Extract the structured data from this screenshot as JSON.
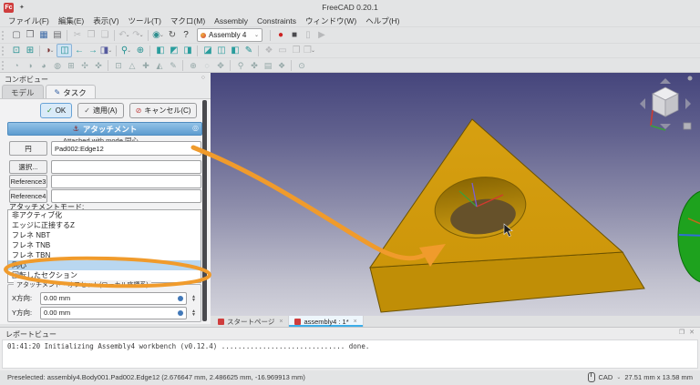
{
  "window": {
    "title": "FreeCAD 0.20.1",
    "logo_text": "Fc"
  },
  "menubar": {
    "items": [
      {
        "name": "menu-file",
        "label": "ファイル(F)"
      },
      {
        "name": "menu-edit",
        "label": "編集(E)"
      },
      {
        "name": "menu-view",
        "label": "表示(V)"
      },
      {
        "name": "menu-tools",
        "label": "ツール(T)"
      },
      {
        "name": "menu-macro",
        "label": "マクロ(M)"
      },
      {
        "name": "menu-assembly",
        "label": "Assembly"
      },
      {
        "name": "menu-constraints",
        "label": "Constraints"
      },
      {
        "name": "menu-windows",
        "label": "ウィンドウ(W)"
      },
      {
        "name": "menu-help",
        "label": "ヘルプ(H)"
      }
    ]
  },
  "workbench_selector": {
    "value": "Assembly 4",
    "dd_icon": "⌄"
  },
  "toolbars": {
    "file": [
      {
        "name": "new-file-icon",
        "glyph": "▢",
        "color": "#6b6b6f"
      },
      {
        "name": "open-file-icon",
        "glyph": "❒",
        "color": "#6b6b6f"
      },
      {
        "name": "save-icon",
        "glyph": "▦",
        "color": "#3f6ca8"
      },
      {
        "name": "print-icon",
        "glyph": "▤",
        "color": "#6b6b6f"
      },
      {
        "name": "separator",
        "cls": "sep",
        "interactable": false
      },
      {
        "name": "cut-icon",
        "glyph": "✂",
        "cls": "disabled"
      },
      {
        "name": "copy-icon",
        "glyph": "❐",
        "cls": "disabled"
      },
      {
        "name": "paste-icon",
        "glyph": "❏",
        "cls": "disabled"
      },
      {
        "name": "separator",
        "cls": "sep",
        "interactable": false
      },
      {
        "name": "undo-icon",
        "glyph": "↶",
        "dd": "⌄",
        "cls": "disabled"
      },
      {
        "name": "redo-icon",
        "glyph": "↷",
        "dd": "⌄",
        "cls": "disabled"
      },
      {
        "name": "separator",
        "cls": "sep",
        "interactable": false
      },
      {
        "name": "workbench-shield-icon",
        "glyph": "◉",
        "dd": "⌄",
        "color": "#2e8f8f"
      },
      {
        "name": "refresh-icon",
        "glyph": "↻",
        "color": "#555"
      },
      {
        "name": "whats-this-icon",
        "glyph": "?",
        "color": "#333"
      }
    ],
    "macro": [
      {
        "name": "separator",
        "cls": "sep",
        "interactable": false
      },
      {
        "name": "macro-record-icon",
        "glyph": "●",
        "color": "#cc2222"
      },
      {
        "name": "macro-stop-icon",
        "glyph": "■",
        "color": "#4a4a4e"
      },
      {
        "name": "macro-step-icon",
        "glyph": "▯",
        "cls": "disabled"
      },
      {
        "name": "macro-play-icon",
        "glyph": "▶",
        "cls": "disabled"
      }
    ],
    "view": [
      {
        "name": "fit-all-icon",
        "glyph": "⊡",
        "color": "#1f8f8f"
      },
      {
        "name": "fit-selection-icon",
        "glyph": "⊞",
        "color": "#1f8f8f"
      },
      {
        "name": "separator",
        "cls": "sep",
        "interactable": false
      },
      {
        "name": "draw-style-icon",
        "glyph": "◑",
        "dd": "⌄",
        "color": "#7a3030"
      },
      {
        "name": "isometric-view-icon",
        "glyph": "◫",
        "color": "#1f8f8f",
        "cls": "active"
      },
      {
        "name": "view-back-icon",
        "glyph": "←",
        "color": "#2a9d9d"
      },
      {
        "name": "view-forward-icon",
        "glyph": "→",
        "color": "#2a9d9d"
      },
      {
        "name": "std-views-icon",
        "glyph": "◨",
        "dd": "⌄",
        "color": "#555a9e"
      },
      {
        "name": "separator",
        "cls": "sep",
        "interactable": false
      },
      {
        "name": "zoom-icon",
        "glyph": "⚲",
        "dd": "⌄",
        "color": "#1f8f8f"
      },
      {
        "name": "axonometric-icon",
        "glyph": "⊕",
        "color": "#1f8f8f"
      },
      {
        "name": "separator",
        "cls": "sep",
        "interactable": false
      },
      {
        "name": "view-front-icon",
        "glyph": "◧",
        "color": "#2a9d9d"
      },
      {
        "name": "view-top-icon",
        "glyph": "◩",
        "color": "#2a9d9d"
      },
      {
        "name": "view-right-icon",
        "glyph": "◨",
        "color": "#2a9d9d"
      },
      {
        "name": "separator",
        "cls": "sep",
        "interactable": false
      },
      {
        "name": "view-rear-icon",
        "glyph": "◪",
        "color": "#2a9d9d"
      },
      {
        "name": "view-bottom-icon",
        "glyph": "◫",
        "color": "#2a9d9d"
      },
      {
        "name": "view-left-icon",
        "glyph": "◧",
        "color": "#2a9d9d"
      },
      {
        "name": "measure-icon",
        "glyph": "✎",
        "color": "#1f8f8f"
      },
      {
        "name": "separator",
        "cls": "sep",
        "interactable": false
      },
      {
        "name": "sync-view-icon",
        "glyph": "❖",
        "cls": "disabled"
      },
      {
        "name": "box-select-icon",
        "glyph": "▭",
        "cls": "disabled"
      },
      {
        "name": "clip-plane-icon",
        "glyph": "❐",
        "cls": "disabled"
      },
      {
        "name": "persp-ortho-icon",
        "glyph": "❒",
        "dd": "⌄",
        "cls": "disabled"
      }
    ],
    "asm4": [
      {
        "name": "asm4-tool-icon-1",
        "glyph": "◔",
        "cls": "pale"
      },
      {
        "name": "asm4-tool-icon-2",
        "glyph": "◑",
        "cls": "pale"
      },
      {
        "name": "asm4-tool-icon-3",
        "glyph": "◕",
        "cls": "pale"
      },
      {
        "name": "asm4-tool-icon-4",
        "glyph": "◍",
        "cls": "pale"
      },
      {
        "name": "asm4-tool-icon-5",
        "glyph": "⊞",
        "cls": "pale"
      },
      {
        "name": "asm4-tool-icon-6",
        "glyph": "✣",
        "cls": "pale"
      },
      {
        "name": "asm4-tool-icon-7",
        "glyph": "✜",
        "cls": "pale"
      },
      {
        "name": "separator",
        "cls": "sep",
        "interactable": false
      },
      {
        "name": "asm4-tool-icon-8",
        "glyph": "⊡",
        "cls": "pale"
      },
      {
        "name": "asm4-tool-icon-9",
        "glyph": "△",
        "cls": "pale"
      },
      {
        "name": "asm4-tool-icon-10",
        "glyph": "✚",
        "cls": "pale"
      },
      {
        "name": "asm4-tool-icon-11",
        "glyph": "◭",
        "cls": "pale"
      },
      {
        "name": "asm4-tool-icon-12",
        "glyph": "✎",
        "cls": "pale"
      },
      {
        "name": "separator",
        "cls": "sep",
        "interactable": false
      },
      {
        "name": "asm4-tool-icon-13",
        "glyph": "⊕",
        "cls": "pale"
      },
      {
        "name": "asm4-tool-icon-14",
        "glyph": "◌",
        "cls": "pale"
      },
      {
        "name": "asm4-tool-icon-15",
        "glyph": "✥",
        "cls": "pale"
      },
      {
        "name": "separator",
        "cls": "sep",
        "interactable": false
      },
      {
        "name": "asm4-tool-icon-16",
        "glyph": "⚲",
        "cls": "pale"
      },
      {
        "name": "asm4-tool-icon-17",
        "glyph": "✤",
        "cls": "pale"
      },
      {
        "name": "asm4-tool-icon-18",
        "glyph": "▤",
        "cls": "pale"
      },
      {
        "name": "asm4-tool-icon-19",
        "glyph": "❖",
        "cls": "pale"
      },
      {
        "name": "separator",
        "cls": "sep",
        "interactable": false
      },
      {
        "name": "asm4-tool-icon-20",
        "glyph": "⊙",
        "cls": "pale"
      }
    ]
  },
  "combo_view": {
    "title": "コンボビュー",
    "float_icon": "○",
    "tabs": [
      {
        "name": "tab-model",
        "label": "モデル"
      },
      {
        "name": "tab-task",
        "label": "タスク"
      }
    ],
    "task": {
      "ok_icon": "✓",
      "ok_label": "OK",
      "apply_icon": "✓",
      "apply_label": "適用(A)",
      "cancel_icon": "⊘",
      "cancel_label": "キャンセル(C)"
    },
    "attachment": {
      "header": "アタッチメント",
      "anchor_icon": "⚓",
      "help_icon": "◎",
      "status_text": "Attached with mode 同心",
      "rows": [
        {
          "button": "円",
          "value": "Pad002:Edge12"
        },
        {
          "button": "選択...",
          "value": ""
        },
        {
          "button": "Reference3",
          "value": ""
        },
        {
          "button": "Reference4",
          "value": ""
        }
      ],
      "mode_label": "アタッチメントモード:",
      "modes": [
        {
          "name": "mode-deactivated",
          "label": "非アクティブ化"
        },
        {
          "name": "mode-z-tangent-to-edge",
          "label": "エッジに正接するZ"
        },
        {
          "name": "mode-frenet-nbt",
          "label": "フレネ NBT"
        },
        {
          "name": "mode-frenet-tnb",
          "label": "フレネ TNB"
        },
        {
          "name": "mode-frenet-tbn",
          "label": "フレネ TBN"
        },
        {
          "name": "mode-concentric",
          "label": "同心",
          "cls": "selected"
        },
        {
          "name": "mode-revolution-section",
          "label": "回転したセクション"
        }
      ],
      "selected_mode": "同心",
      "offset": {
        "title": "アタッチメント・オフセット(ローカル座標系)",
        "rows": [
          {
            "label": "X方向:",
            "value": "0.00 mm"
          },
          {
            "label": "Y方向:",
            "value": "0.00 mm"
          }
        ],
        "spin_up": "▲",
        "spin_down": "▼"
      }
    }
  },
  "mdi_tabs": [
    {
      "name": "tab-start-page",
      "label": "スタートページ",
      "close": "×"
    },
    {
      "name": "tab-assembly4-document",
      "label": "assembly4 : 1*",
      "close": "×",
      "cls": "active"
    }
  ],
  "report_view": {
    "title": "レポートビュー",
    "float_icon": "❐",
    "close_icon": "✕",
    "log_line": "01:41:20  Initializing Assembly4 workbench (v0.12.4) .............................. done."
  },
  "statusbar": {
    "message": "Preselected: assembly4.Body001.Pad002.Edge12 (2.676647 mm, 2.486625 mm, -16.969913 mm)",
    "nav_style": "CAD",
    "dd_icon": "⌄",
    "dimensions": "27.51 mm x 13.58 mm"
  },
  "colors": {
    "accent": "#3daee9",
    "annotation_orange": "#f09b2c",
    "part_gold_top": "#d29b0b",
    "part_gold_front": "#c08e06",
    "selection_blue": "#b9d7f0",
    "datum_green": "#1ea21e",
    "viewport_top": "#45457c",
    "viewport_bottom": "#d3d3dc"
  }
}
